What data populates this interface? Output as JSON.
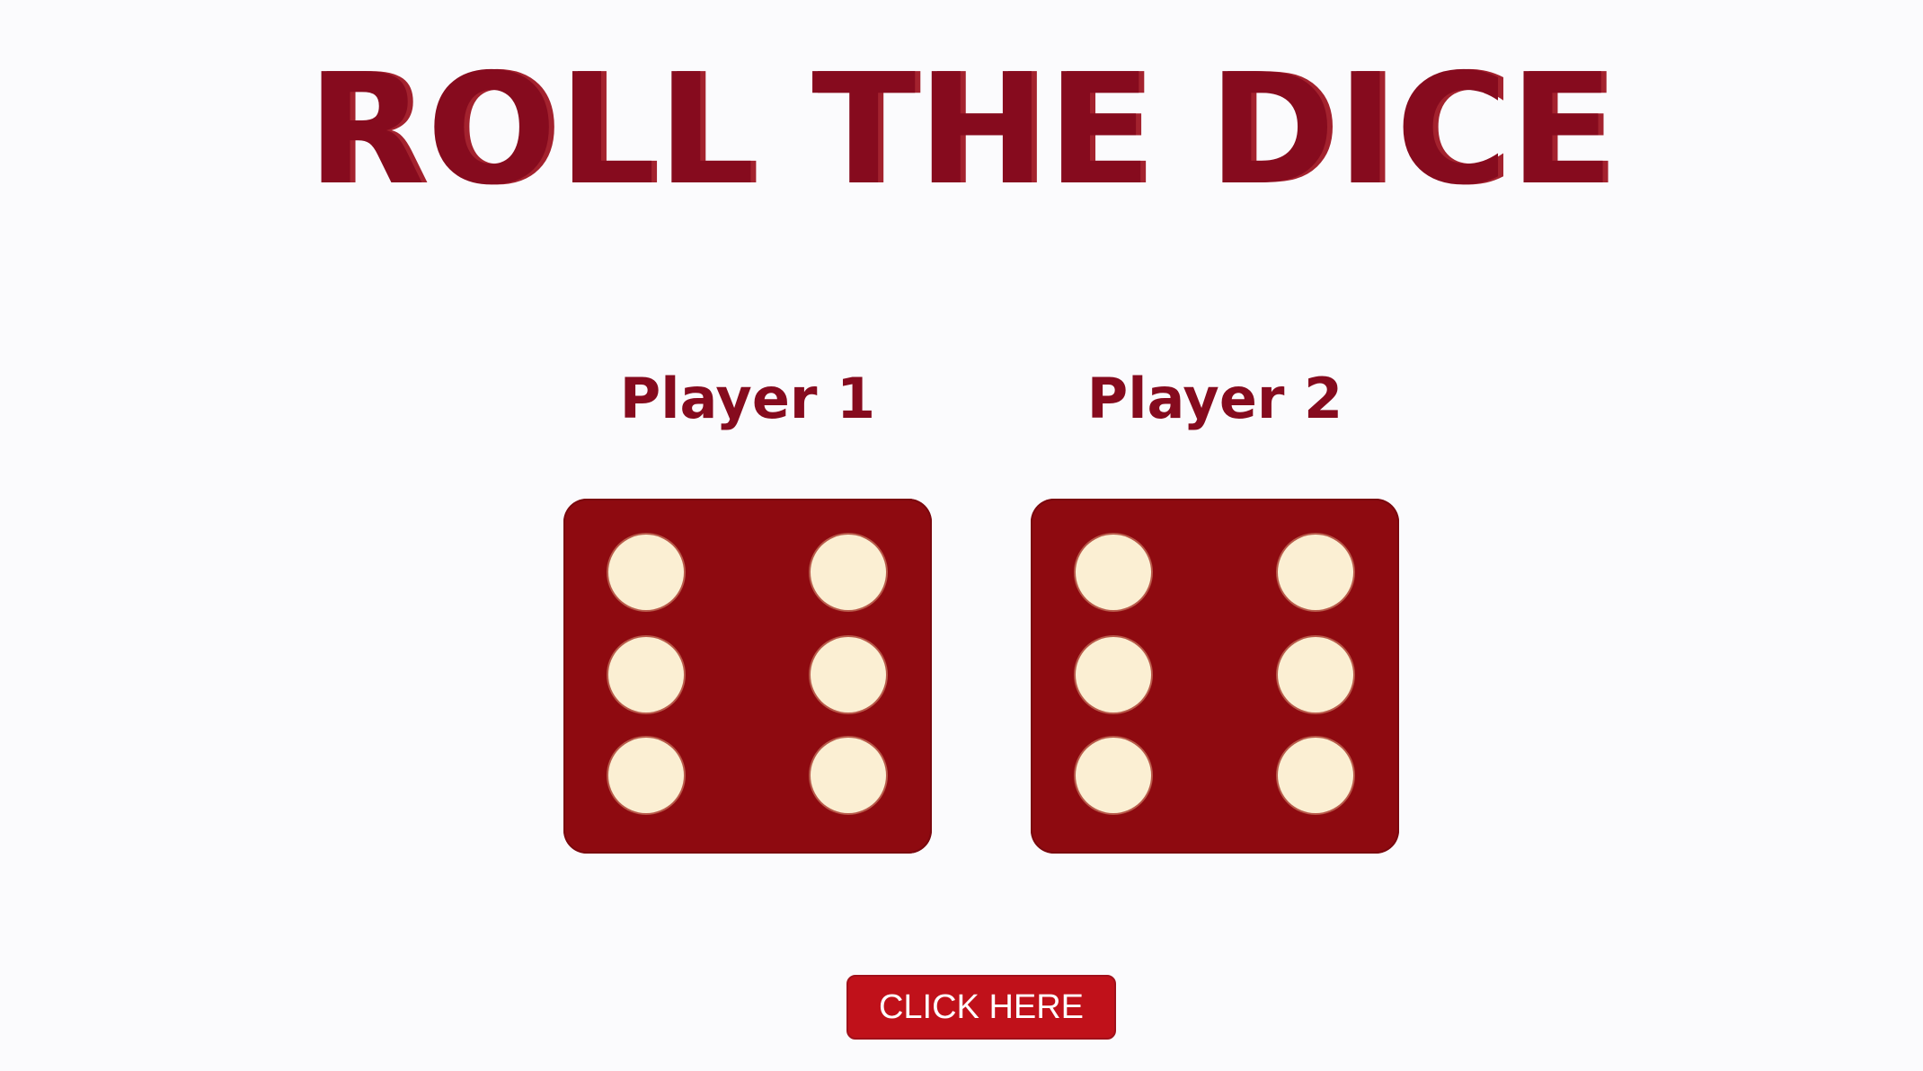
{
  "title": "ROLL THE DICE",
  "players": [
    {
      "label": "Player 1",
      "die_value": 6
    },
    {
      "label": "Player 2",
      "die_value": 6
    }
  ],
  "button": {
    "label": "CLICK HERE"
  },
  "colors": {
    "accent": "#860b1e",
    "die_face": "#8e0a10",
    "pip": "#fbefd3",
    "button": "#c0111a",
    "background": "#fbfbfd"
  }
}
